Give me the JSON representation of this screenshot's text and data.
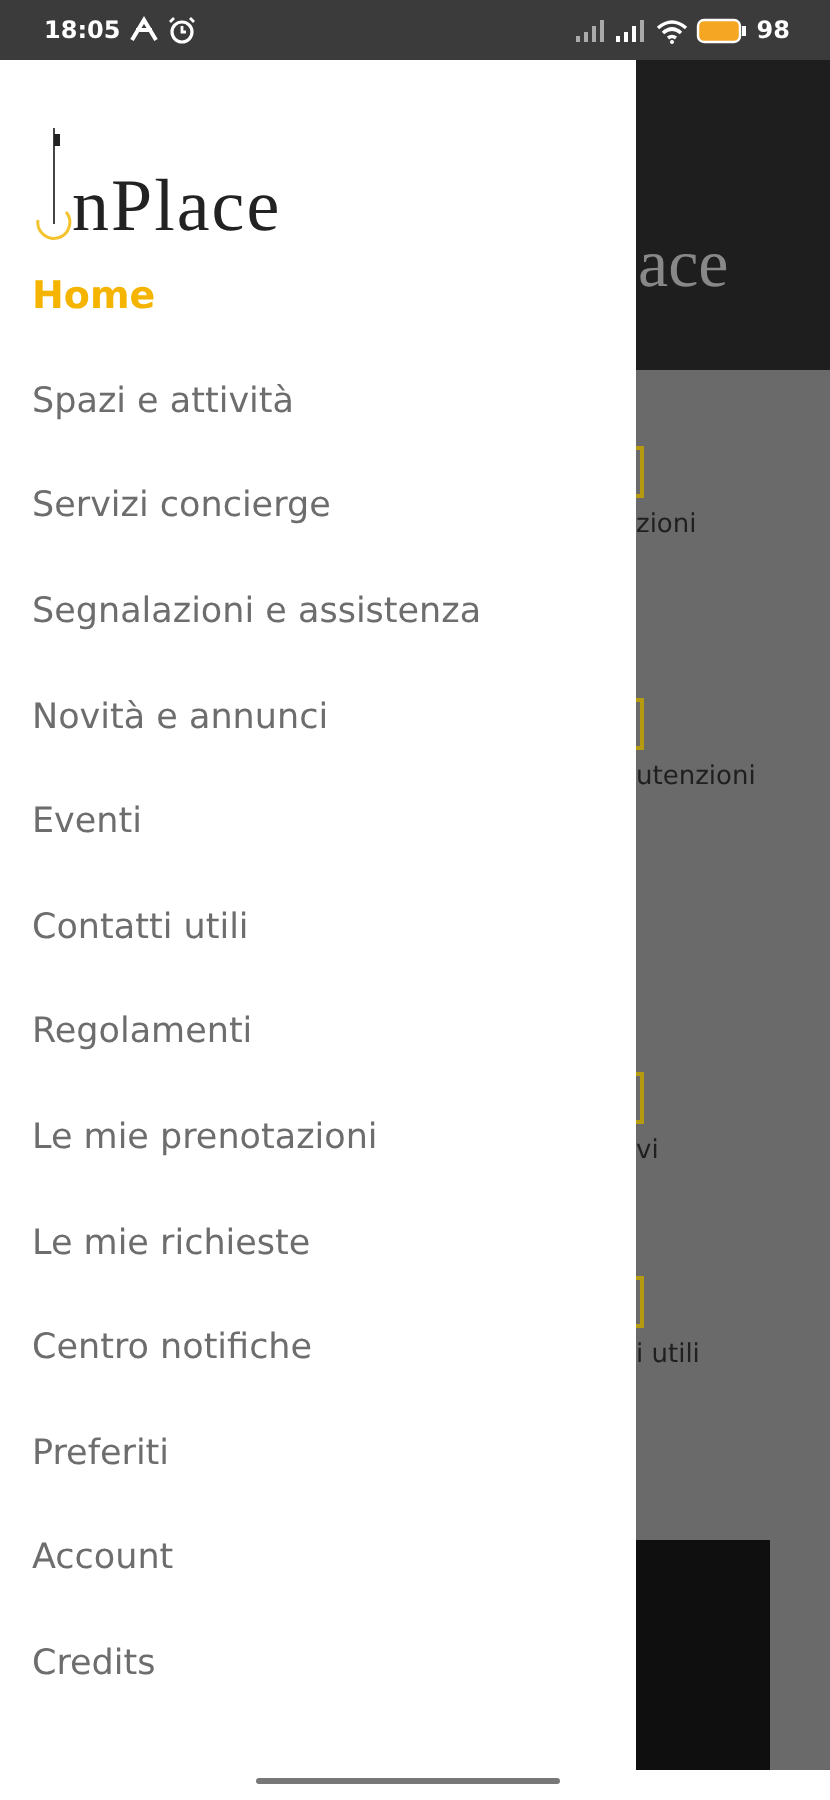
{
  "status_bar": {
    "time": "18:05",
    "battery": "98"
  },
  "drawer": {
    "logo": "nPlace",
    "items": [
      {
        "label": "Home",
        "selected": true
      },
      {
        "label": "Spazi e attività",
        "selected": false
      },
      {
        "label": "Servizi concierge",
        "selected": false
      },
      {
        "label": "Segnalazioni e assistenza",
        "selected": false
      },
      {
        "label": "Novità e annunci",
        "selected": false
      },
      {
        "label": "Eventi",
        "selected": false
      },
      {
        "label": "Contatti utili",
        "selected": false
      },
      {
        "label": "Regolamenti",
        "selected": false
      },
      {
        "label": "Le mie prenotazioni",
        "selected": false
      },
      {
        "label": "Le mie richieste",
        "selected": false
      },
      {
        "label": "Centro notifiche",
        "selected": false
      },
      {
        "label": "Preferiti",
        "selected": false
      },
      {
        "label": "Account",
        "selected": false
      },
      {
        "label": "Credits",
        "selected": false
      }
    ]
  },
  "background": {
    "title": "ace",
    "tiles": [
      {
        "label": "zioni"
      },
      {
        "label": "utenzioni"
      },
      {
        "label": "vi"
      },
      {
        "label": "i utili"
      }
    ]
  }
}
